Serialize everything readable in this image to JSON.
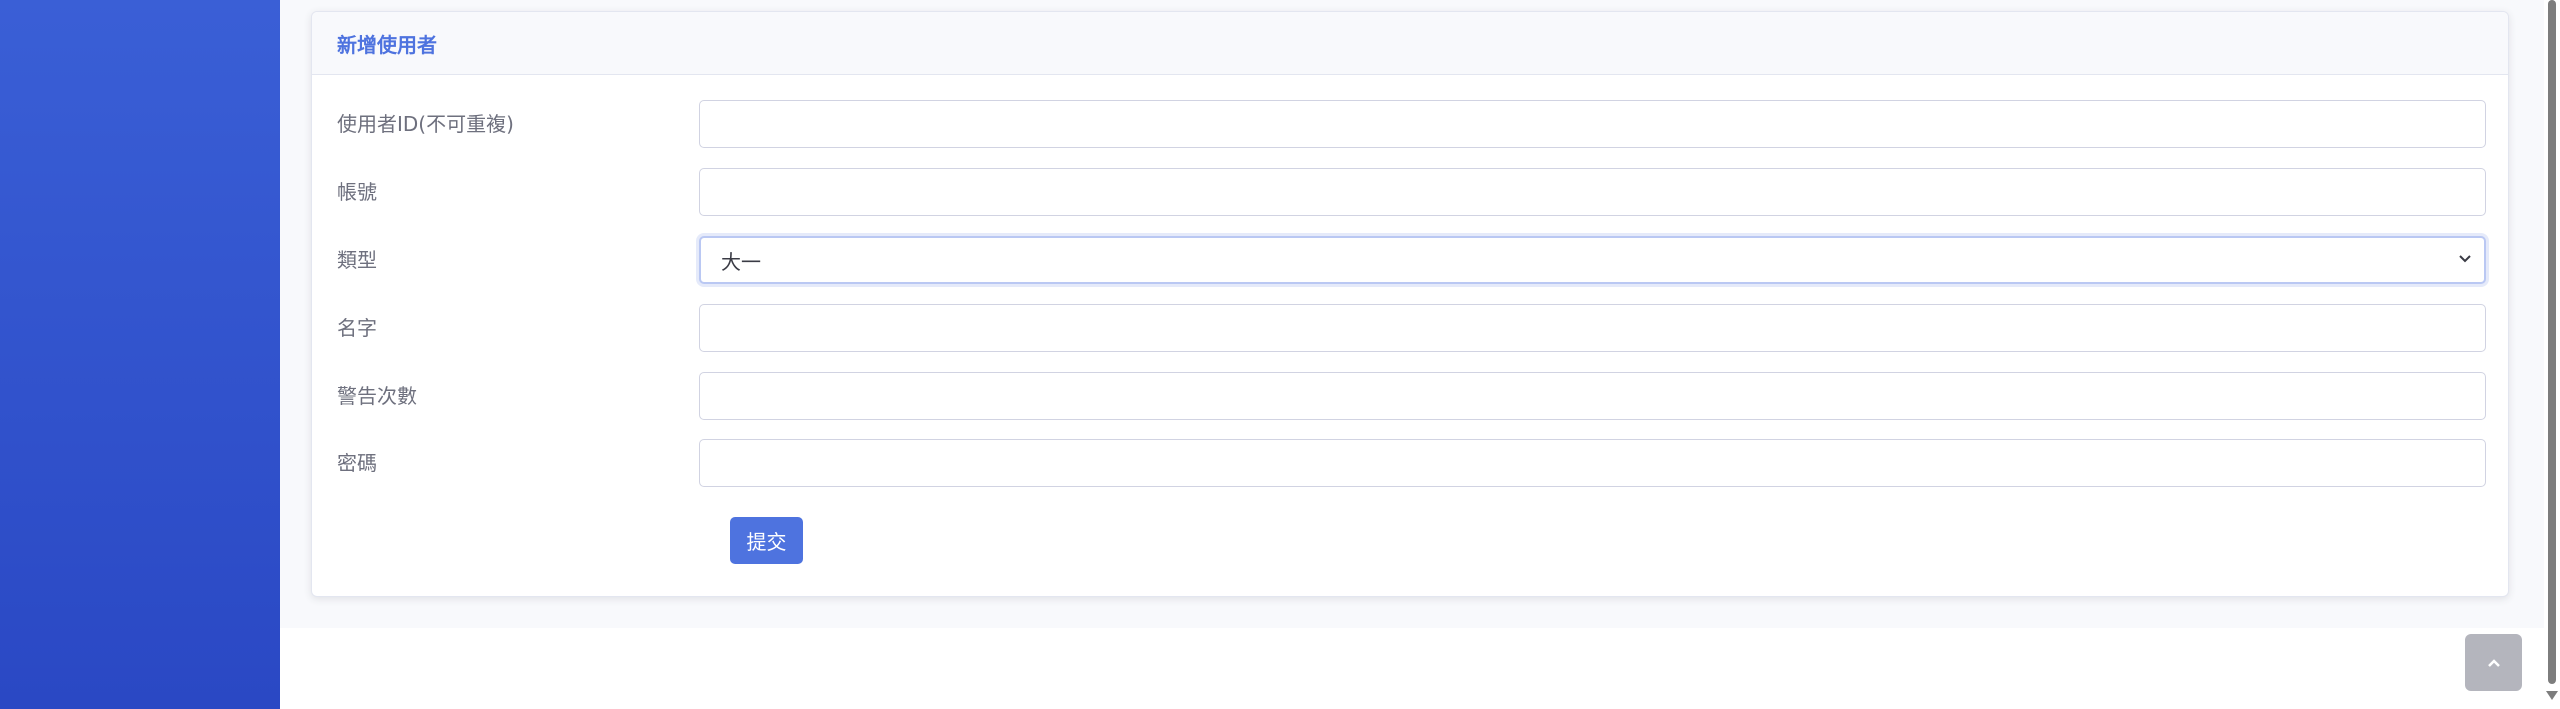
{
  "card": {
    "title": "新增使用者"
  },
  "form": {
    "fields": [
      {
        "label": "使用者ID(不可重複)",
        "value": ""
      },
      {
        "label": "帳號",
        "value": ""
      },
      {
        "label": "類型",
        "selected": "大一"
      },
      {
        "label": "名字",
        "value": ""
      },
      {
        "label": "警告次數",
        "value": ""
      },
      {
        "label": "密碼",
        "value": ""
      }
    ],
    "submit_label": "提交"
  },
  "icons": {
    "scroll_top": "chevron-up-icon",
    "select_chevron": "chevron-down-icon"
  },
  "colors": {
    "primary": "#4e73df",
    "sidebar": "#3a5fd6",
    "scroll_top_bg": "#b4b5bd"
  }
}
